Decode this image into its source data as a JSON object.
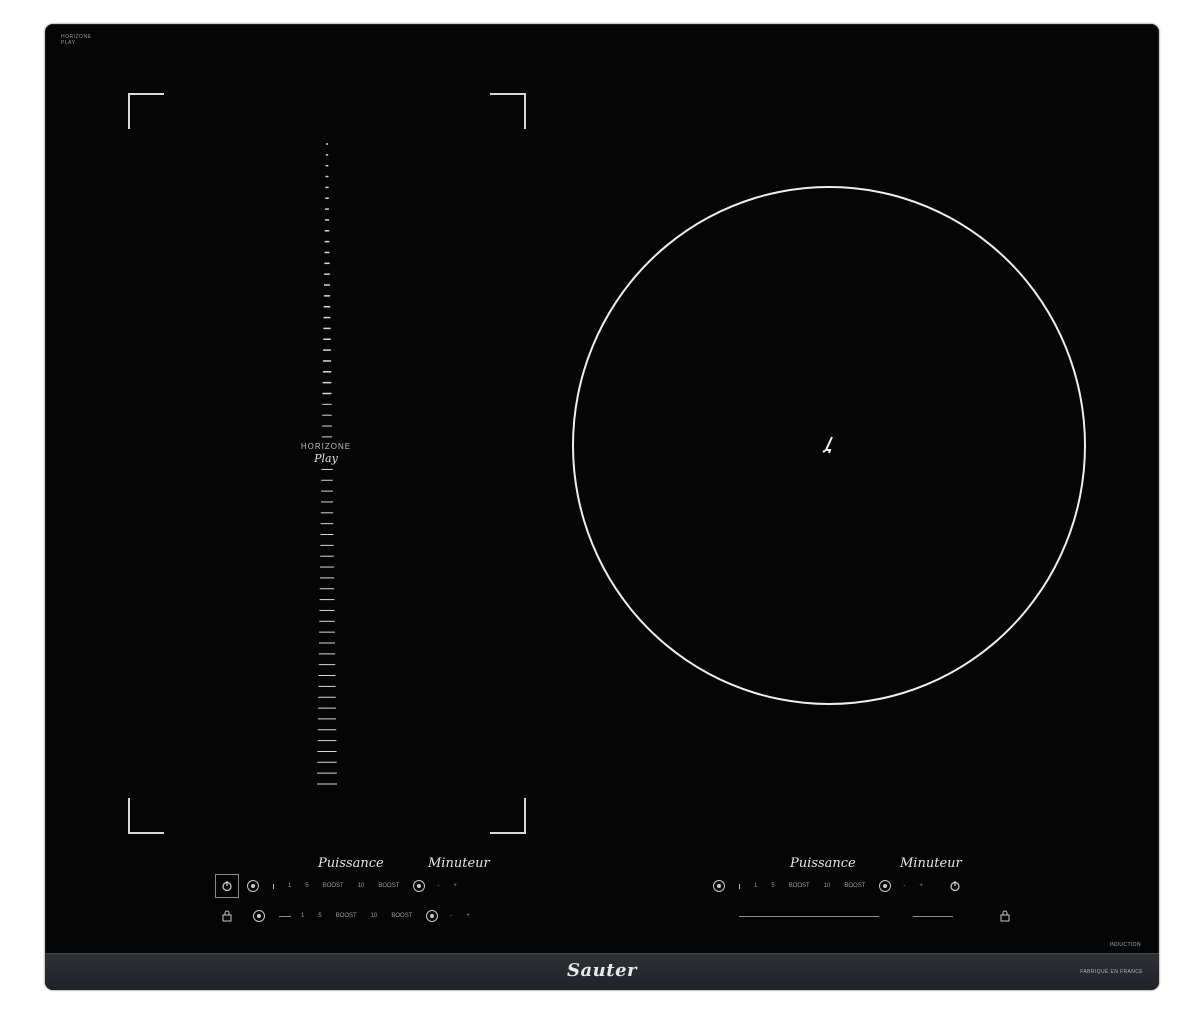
{
  "product": {
    "top_logo": "HORIZONE PLAY",
    "induction_tag": "INDUCTION",
    "brand": "Sauter",
    "brand_footnote": "FABRIQUÉ EN FRANCE"
  },
  "horizone_zone": {
    "name": "HORIZONE",
    "script": "Play"
  },
  "left_controls": {
    "script_left": "Puissance",
    "script_right": "Minuteur",
    "row1_values": [
      "1",
      "5",
      "BOOST",
      "10",
      "BOOST"
    ],
    "row2_values": [
      "1",
      "5",
      "BOOST",
      "10",
      "BOOST"
    ],
    "timer_values": [
      "-",
      "+"
    ]
  },
  "right_controls": {
    "script_left": "Puissance",
    "script_right": "Minuteur",
    "row_values": [
      "1",
      "5",
      "BOOST",
      "10",
      "BOOST"
    ],
    "timer_values": [
      "-",
      "+"
    ]
  },
  "colors": {
    "glass": "#050505",
    "markings": "#eeeeee",
    "brand_bar": "#2e3236"
  },
  "icons": {
    "power": "power-icon",
    "lock": "lock-icon",
    "zone_select": "zone-select-icon",
    "timer": "timer-icon",
    "circle_marker": "zone-marker-icon"
  }
}
